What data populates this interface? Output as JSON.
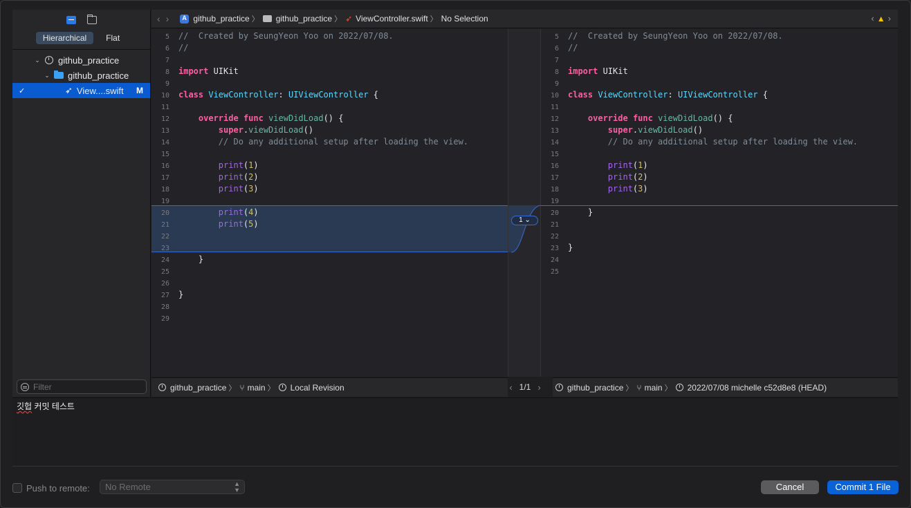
{
  "navigator": {
    "segments": [
      "Hierarchical",
      "Flat"
    ],
    "tree": [
      {
        "label": "github_practice"
      },
      {
        "label": "github_practice"
      },
      {
        "label": "View....swift",
        "badge": "M"
      }
    ],
    "filter_placeholder": "Filter"
  },
  "breadcrumb": {
    "items": [
      "github_practice",
      "github_practice",
      "ViewController.swift",
      "No Selection"
    ]
  },
  "left_lines": [
    {
      "n": "5",
      "code": "//  Created by SeungYeon Yoo on 2022/07/08."
    },
    {
      "n": "6",
      "code": "//"
    },
    {
      "n": "7",
      "code": ""
    },
    {
      "n": "8",
      "code": "import UIKit"
    },
    {
      "n": "9",
      "code": ""
    },
    {
      "n": "10",
      "code": "class ViewController: UIViewController {"
    },
    {
      "n": "11",
      "code": ""
    },
    {
      "n": "12",
      "code": "    override func viewDidLoad() {"
    },
    {
      "n": "13",
      "code": "        super.viewDidLoad()"
    },
    {
      "n": "14",
      "code": "        // Do any additional setup after loading the view."
    },
    {
      "n": "15",
      "code": ""
    },
    {
      "n": "16",
      "code": "        print(1)"
    },
    {
      "n": "17",
      "code": "        print(2)"
    },
    {
      "n": "18",
      "code": "        print(3)"
    },
    {
      "n": "19",
      "code": ""
    },
    {
      "n": "20",
      "code": "        print(4)"
    },
    {
      "n": "21",
      "code": "        print(5)"
    },
    {
      "n": "22",
      "code": ""
    },
    {
      "n": "23",
      "code": ""
    },
    {
      "n": "24",
      "code": "    }"
    },
    {
      "n": "25",
      "code": ""
    },
    {
      "n": "26",
      "code": ""
    },
    {
      "n": "27",
      "code": "}"
    },
    {
      "n": "28",
      "code": ""
    },
    {
      "n": "29",
      "code": ""
    }
  ],
  "right_lines": [
    {
      "n": "5",
      "code": "//  Created by SeungYeon Yoo on 2022/07/08."
    },
    {
      "n": "6",
      "code": "//"
    },
    {
      "n": "7",
      "code": ""
    },
    {
      "n": "8",
      "code": "import UIKit"
    },
    {
      "n": "9",
      "code": ""
    },
    {
      "n": "10",
      "code": "class ViewController: UIViewController {"
    },
    {
      "n": "11",
      "code": ""
    },
    {
      "n": "12",
      "code": "    override func viewDidLoad() {"
    },
    {
      "n": "13",
      "code": "        super.viewDidLoad()"
    },
    {
      "n": "14",
      "code": "        // Do any additional setup after loading the view."
    },
    {
      "n": "15",
      "code": ""
    },
    {
      "n": "16",
      "code": "        print(1)"
    },
    {
      "n": "17",
      "code": "        print(2)"
    },
    {
      "n": "18",
      "code": "        print(3)"
    },
    {
      "n": "19",
      "code": ""
    },
    {
      "n": "20",
      "code": "    }"
    },
    {
      "n": "21",
      "code": ""
    },
    {
      "n": "22",
      "code": ""
    },
    {
      "n": "23",
      "code": "}"
    },
    {
      "n": "24",
      "code": ""
    },
    {
      "n": "25",
      "code": ""
    }
  ],
  "diff": {
    "changes_label": "1 ⌄"
  },
  "status_left": {
    "project": "github_practice",
    "branch": "main",
    "revision": "Local Revision"
  },
  "pager": {
    "label": "1/1"
  },
  "status_right": {
    "project": "github_practice",
    "branch": "main",
    "revision": "2022/07/08  michelle  c52d8e8 (HEAD)"
  },
  "commit_message": {
    "prefix": "깃헙",
    "rest": " 커밋 테스트"
  },
  "footer": {
    "push_label": "Push to remote:",
    "remote_value": "No Remote",
    "cancel_label": "Cancel",
    "commit_label": "Commit 1 File"
  },
  "colors": {
    "accent": "#0a63d6",
    "diff_highlight": "#2a3a52",
    "keyword": "#fc5fa3",
    "type": "#5dd8ff"
  }
}
